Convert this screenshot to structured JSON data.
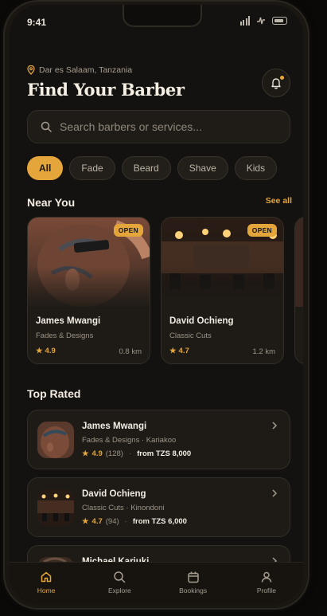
{
  "status": {
    "time": "9:41"
  },
  "header": {
    "location": "Dar es Salaam, Tanzania",
    "title": "Find Your Barber"
  },
  "search": {
    "placeholder": "Search barbers or services..."
  },
  "filters": [
    "All",
    "Fade",
    "Beard",
    "Shave",
    "Kids"
  ],
  "near_you": {
    "title": "Near You",
    "see_all": "See all",
    "cards": [
      {
        "badge": "OPEN",
        "name": "James Mwangi",
        "specialty": "Fades & Designs",
        "rating": "4.9",
        "distance": "0.8 km"
      },
      {
        "badge": "OPEN",
        "name": "David Ochieng",
        "specialty": "Classic Cuts",
        "rating": "4.7",
        "distance": "1.2 km"
      }
    ]
  },
  "top_rated": {
    "title": "Top Rated",
    "items": [
      {
        "name": "James Mwangi",
        "subtitle": "Fades & Designs · Kariakoo",
        "rating": "4.9",
        "count": "(128)",
        "price": "from TZS 8,000"
      },
      {
        "name": "David Ochieng",
        "subtitle": "Classic Cuts · Kinondoni",
        "rating": "4.7",
        "count": "(94)",
        "price": "from TZS 6,000"
      },
      {
        "name": "Michael Kariuki",
        "subtitle": "",
        "rating": "",
        "count": "",
        "price": ""
      }
    ]
  },
  "tabs": [
    {
      "label": "Home",
      "icon": "home-icon",
      "active": true
    },
    {
      "label": "Explore",
      "icon": "search-icon",
      "active": false
    },
    {
      "label": "Bookings",
      "icon": "calendar-icon",
      "active": false
    },
    {
      "label": "Profile",
      "icon": "user-icon",
      "active": false
    }
  ],
  "colors": {
    "accent": "#e4a53b",
    "background": "#141210",
    "card": "#1e1b17"
  }
}
